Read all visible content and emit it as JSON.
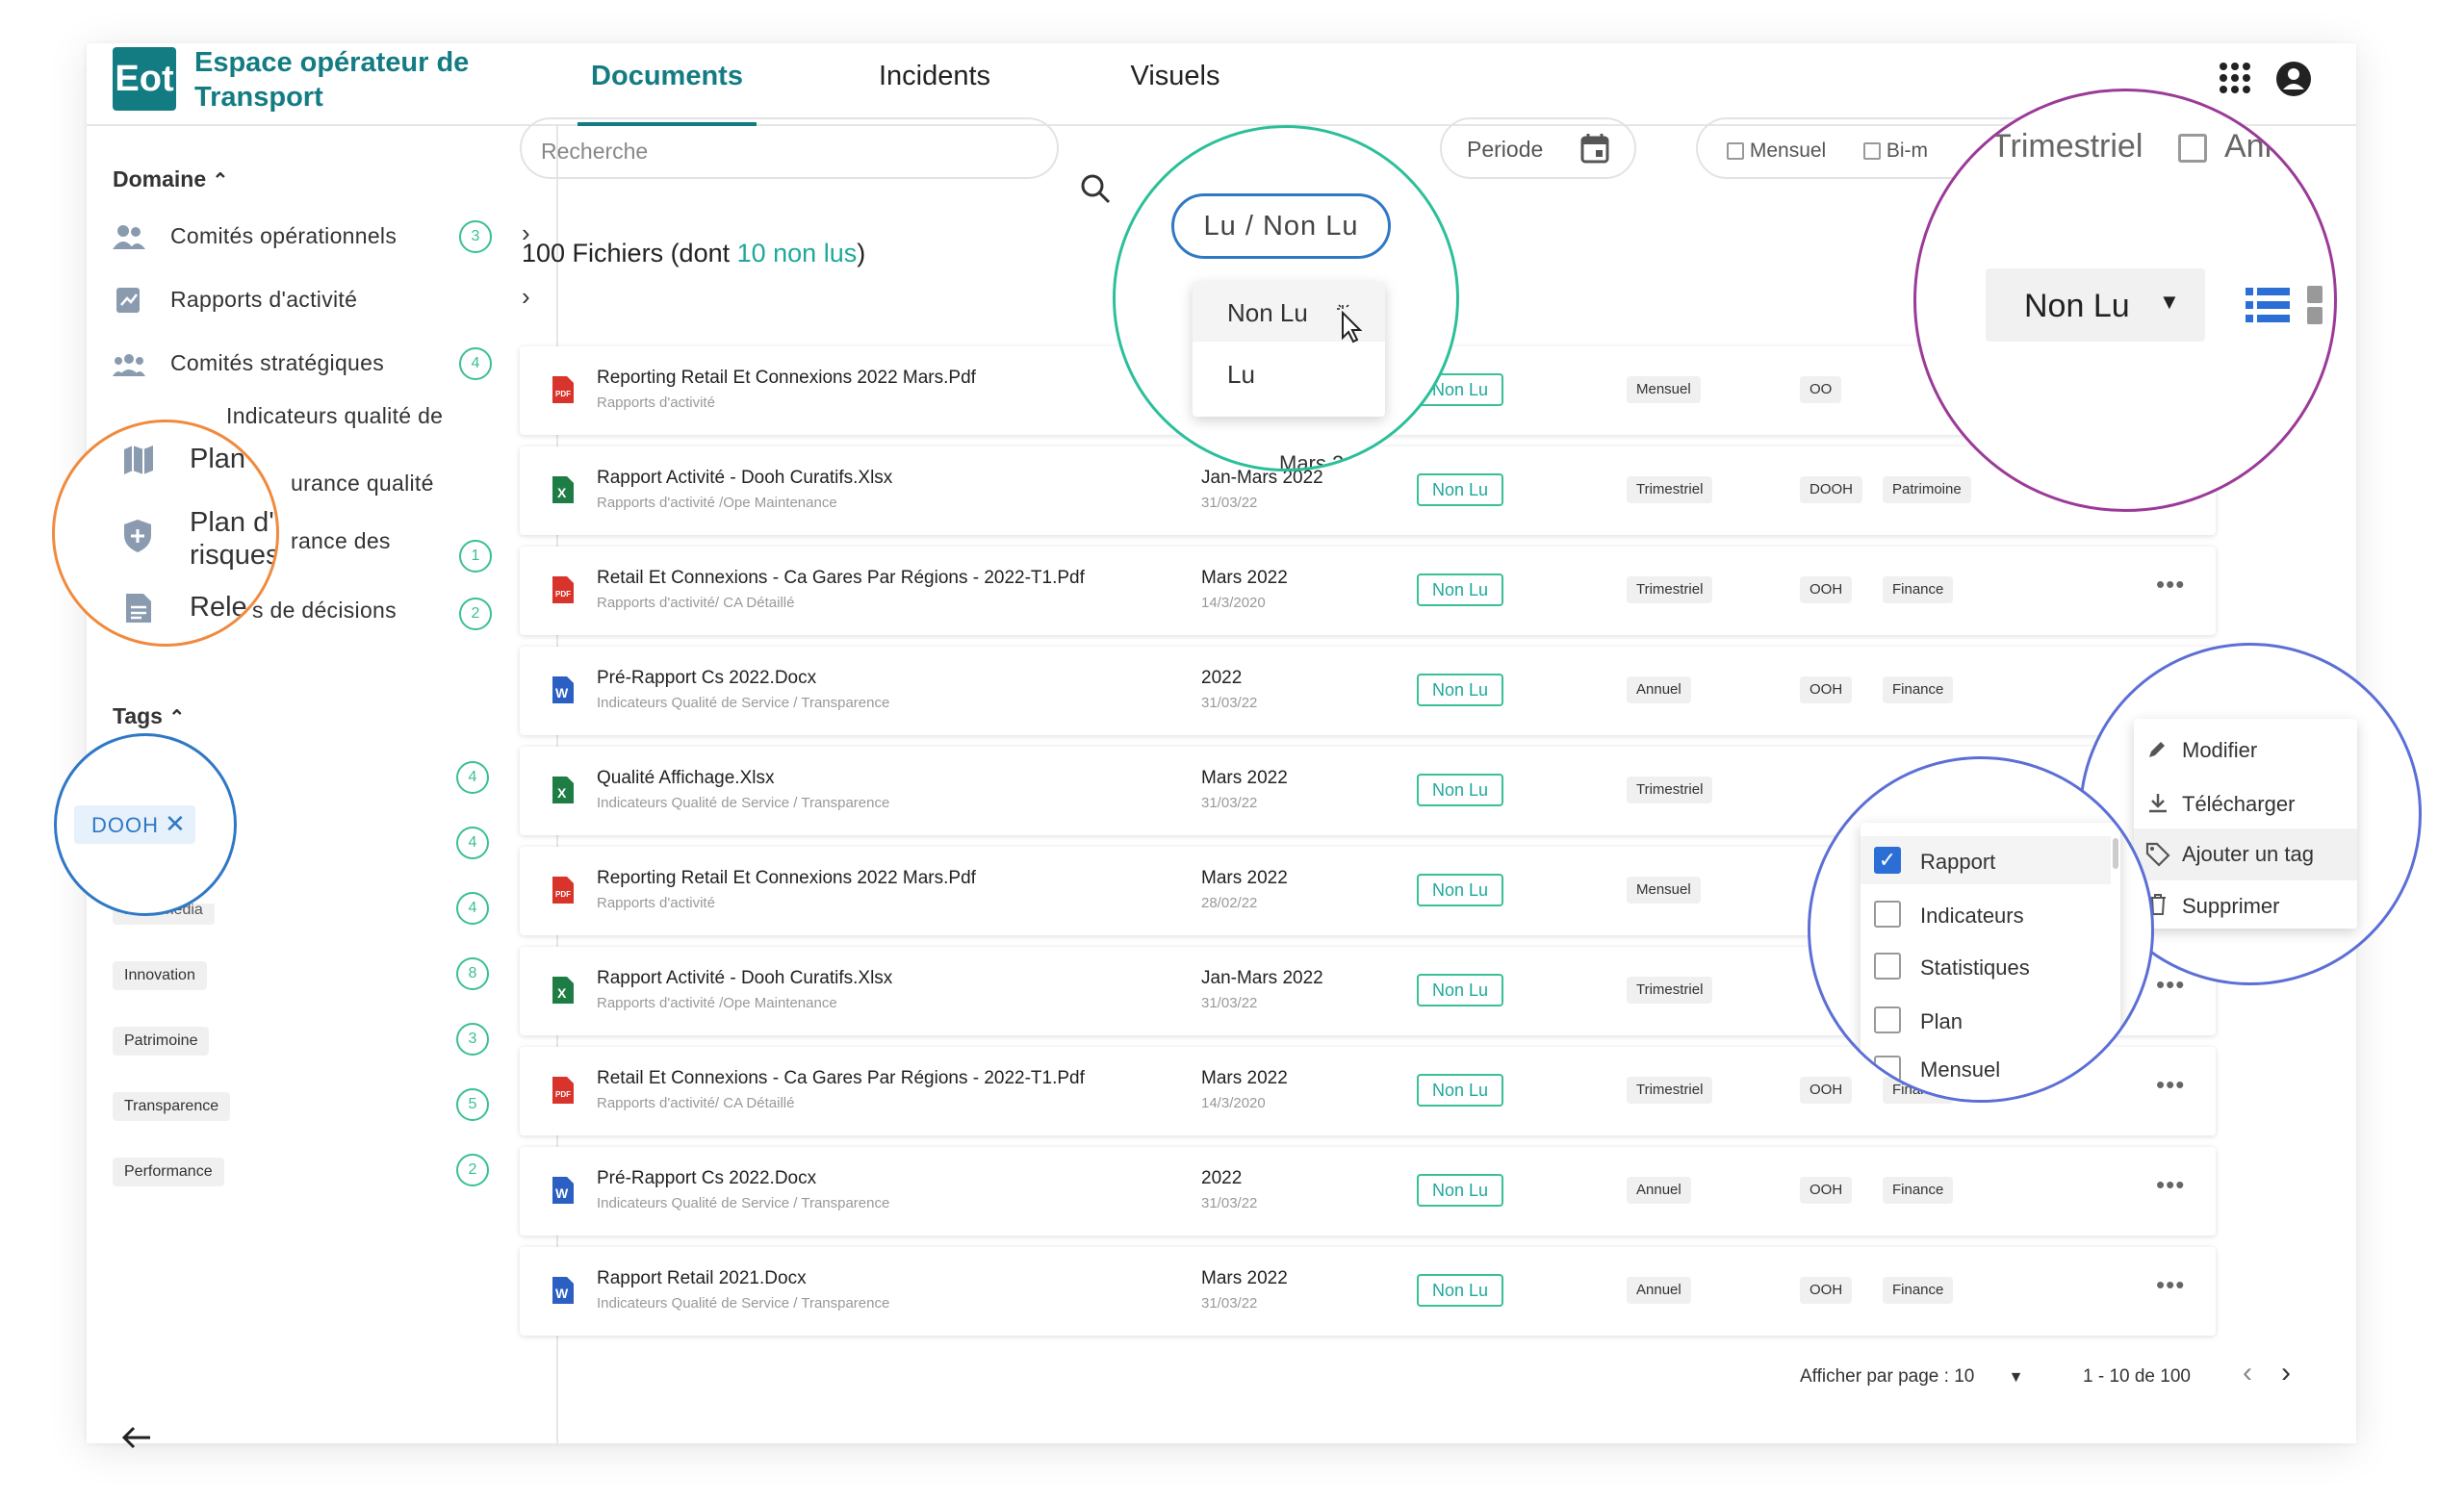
{
  "app": {
    "logo": "Eot",
    "title": "Espace opérateur de Transport"
  },
  "tabs": [
    {
      "label": "Documents",
      "active": true
    },
    {
      "label": "Incidents"
    },
    {
      "label": "Visuels"
    }
  ],
  "sidebar": {
    "domain_title": "Domaine",
    "domains": [
      {
        "label": "Comités opérationnels",
        "count": "3"
      },
      {
        "label": "Rapports d'activité"
      },
      {
        "label": "Comités stratégiques",
        "count": "4"
      },
      {
        "label": "Indicateurs qualité de"
      },
      {
        "label": "Plan d'assurance qualité"
      },
      {
        "label": "Plan d'assurance des risques",
        "count": "1"
      },
      {
        "label": "Relevés de décisions",
        "count": "2"
      }
    ],
    "tags_title": "Tags",
    "tags": [
      {
        "label": "DOOH",
        "count": "4"
      },
      {
        "label": "",
        "count": "4"
      },
      {
        "label": "Hors media",
        "count": "4"
      },
      {
        "label": "Innovation",
        "count": "8"
      },
      {
        "label": "Patrimoine",
        "count": "3"
      },
      {
        "label": "Transparence",
        "count": "5"
      },
      {
        "label": "Performance",
        "count": "2"
      }
    ]
  },
  "toolbar": {
    "search_placeholder": "Recherche",
    "read_filter": "Lu / Non Lu",
    "period": "Periode",
    "mensuel": "Mensuel",
    "bimensuel": "Bi-m",
    "trimestriel": "Trimestriel",
    "annuel": "Ann"
  },
  "files_count": {
    "prefix": "100 Fichiers (dont ",
    "highlight": "10 non lus",
    "suffix": ")"
  },
  "read_dropdown": {
    "selected": "Non Lu",
    "options": [
      "Non Lu",
      "Lu"
    ]
  },
  "files": [
    {
      "name": "Reporting Retail Et Connexions 2022 Mars.Pdf",
      "path": "Rapports d'activité",
      "type": "pdf",
      "date": "",
      "date2": "",
      "status": "Non Lu",
      "freq": "Mensuel",
      "tag1": "OO",
      "tag2": ""
    },
    {
      "name": "Rapport Activité - Dooh Curatifs.Xlsx",
      "path": "Rapports d'activité /Ope Maintenance",
      "type": "xls",
      "date": "Jan-Mars 2022",
      "date2": "31/03/22",
      "status": "Non Lu",
      "freq": "Trimestriel",
      "tag1": "DOOH",
      "tag2": "Patrimoine"
    },
    {
      "name": "Retail Et Connexions - Ca Gares Par Régions - 2022-T1.Pdf",
      "path": "Rapports d'activité/ CA Détaillé",
      "type": "pdf",
      "date": "Mars 2022",
      "date2": "14/3/2020",
      "status": "Non Lu",
      "freq": "Trimestriel",
      "tag1": "OOH",
      "tag2": "Finance"
    },
    {
      "name": "Pré-Rapport Cs 2022.Docx",
      "path": "Indicateurs Qualité de Service / Transparence",
      "type": "doc",
      "date": "2022",
      "date2": "31/03/22",
      "status": "Non Lu",
      "freq": "Annuel",
      "tag1": "OOH",
      "tag2": "Finance"
    },
    {
      "name": "Qualité Affichage.Xlsx",
      "path": "Indicateurs Qualité de Service / Transparence",
      "type": "xls",
      "date": "Mars 2022",
      "date2": "31/03/22",
      "status": "Non Lu",
      "freq": "Trimestriel",
      "tag1": "",
      "tag2": ""
    },
    {
      "name": "Reporting Retail Et Connexions 2022 Mars.Pdf",
      "path": "Rapports d'activité",
      "type": "pdf",
      "date": "Mars 2022",
      "date2": "28/02/22",
      "status": "Non Lu",
      "freq": "Mensuel",
      "tag1": "",
      "tag2": ""
    },
    {
      "name": "Rapport Activité - Dooh Curatifs.Xlsx",
      "path": "Rapports d'activité /Ope Maintenance",
      "type": "xls",
      "date": "Jan-Mars 2022",
      "date2": "31/03/22",
      "status": "Non Lu",
      "freq": "Trimestriel",
      "tag1": "",
      "tag2": ""
    },
    {
      "name": "Retail Et Connexions - Ca Gares Par Régions - 2022-T1.Pdf",
      "path": "Rapports d'activité/ CA Détaillé",
      "type": "pdf",
      "date": "Mars 2022",
      "date2": "14/3/2020",
      "status": "Non Lu",
      "freq": "Trimestriel",
      "tag1": "OOH",
      "tag2": "Finance"
    },
    {
      "name": "Pré-Rapport Cs 2022.Docx",
      "path": "Indicateurs Qualité de Service / Transparence",
      "type": "doc",
      "date": "2022",
      "date2": "31/03/22",
      "status": "Non Lu",
      "freq": "Annuel",
      "tag1": "OOH",
      "tag2": "Finance"
    },
    {
      "name": "Rapport Retail  2021.Docx",
      "path": "Indicateurs Qualité de Service / Transparence",
      "type": "doc",
      "date": "Mars 2022",
      "date2": "31/03/22",
      "status": "Non Lu",
      "freq": "Annuel",
      "tag1": "OOH",
      "tag2": "Finance"
    }
  ],
  "pagination": {
    "per_page_label": "Afficher par page : 10",
    "range": "1 - 10 de 100"
  },
  "zooms": {
    "sidebar_zoom": {
      "item1": "Plan d",
      "item2a": "Plan d'",
      "item2b": "risques",
      "item3": "Rele"
    },
    "tag_zoom": {
      "chip": "DOOH"
    },
    "read_zoom": {
      "pill": "Lu / Non Lu",
      "options": [
        "Non Lu",
        "Lu"
      ]
    },
    "topright_zoom": {
      "trimestriel": "Trimestriel",
      "annuel": "Ann",
      "select": "Non Lu"
    },
    "tag_picker": {
      "options": [
        {
          "label": "Rapport",
          "checked": true
        },
        {
          "label": "Indicateurs"
        },
        {
          "label": "Statistiques"
        },
        {
          "label": "Plan"
        },
        {
          "label": "Mensuel"
        }
      ]
    },
    "row_menu": {
      "options": [
        "Modifier",
        "Télécharger",
        "Ajouter un tag",
        "Supprimer"
      ]
    }
  },
  "colors": {
    "brand": "#137c83",
    "accent": "#1fa89a",
    "zoom_orange": "#f08a3e",
    "zoom_blue": "#2f78c6",
    "zoom_teal": "#2bbf9a",
    "zoom_purple": "#9b3a98",
    "zoom_indigo": "#5b6fd6"
  }
}
